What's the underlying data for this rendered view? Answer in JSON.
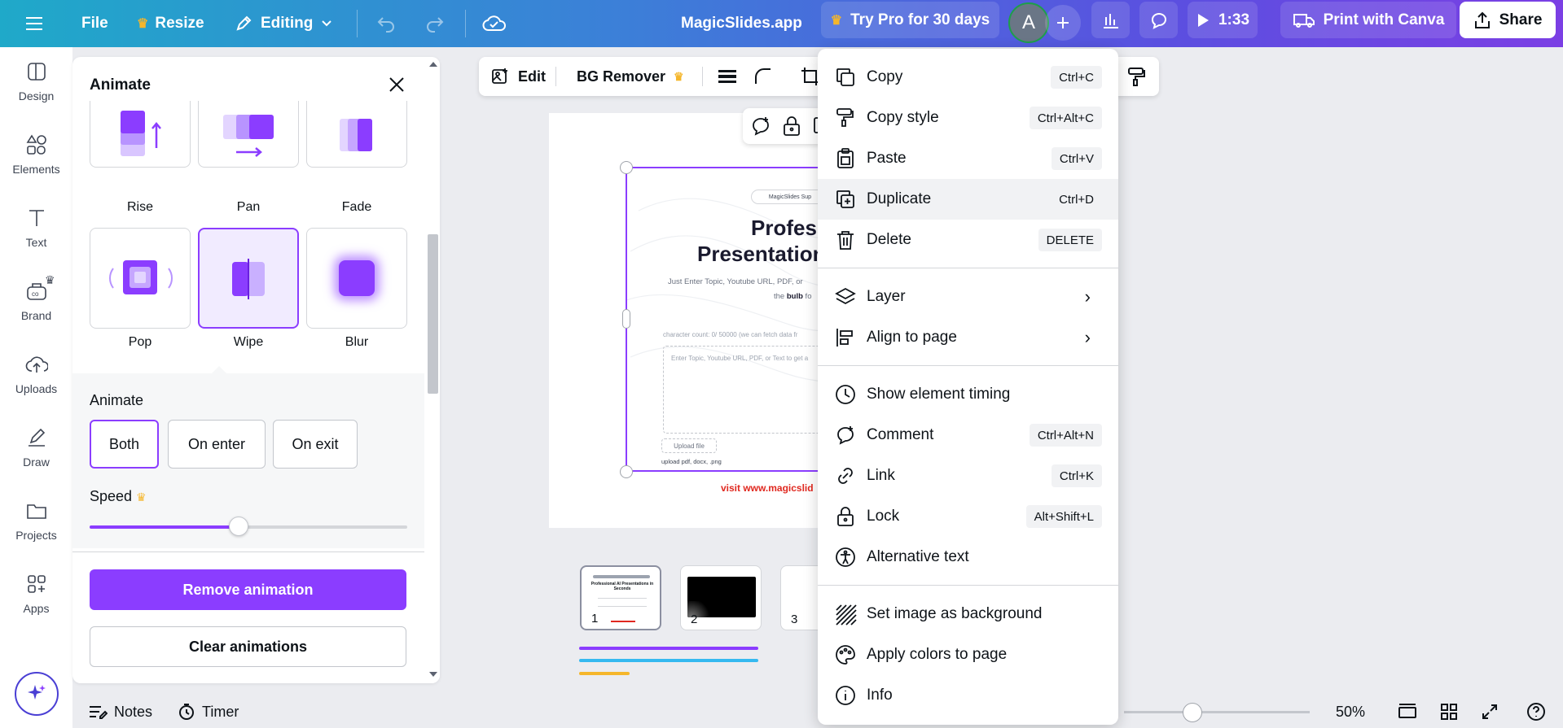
{
  "topbar": {
    "file": "File",
    "resize": "Resize",
    "editing": "Editing",
    "doc_title": "MagicSlides.app",
    "try_pro": "Try Pro for 30 days",
    "avatar_letter": "A",
    "play_time": "1:33",
    "print": "Print with Canva",
    "share": "Share"
  },
  "rail": [
    {
      "label": "Design",
      "icon": "design-icon"
    },
    {
      "label": "Elements",
      "icon": "elements-icon"
    },
    {
      "label": "Text",
      "icon": "text-icon"
    },
    {
      "label": "Brand",
      "icon": "brand-icon"
    },
    {
      "label": "Uploads",
      "icon": "uploads-icon"
    },
    {
      "label": "Draw",
      "icon": "draw-icon"
    },
    {
      "label": "Projects",
      "icon": "projects-icon"
    },
    {
      "label": "Apps",
      "icon": "apps-icon"
    }
  ],
  "panel": {
    "title": "Animate",
    "animations": [
      "Rise",
      "Pan",
      "Fade",
      "Pop",
      "Wipe",
      "Blur"
    ],
    "selected_animation": "Wipe",
    "animate_label": "Animate",
    "options": [
      "Both",
      "On enter",
      "On exit"
    ],
    "selected_option": "Both",
    "speed_label": "Speed",
    "speed_fraction": 0.47,
    "remove": "Remove animation",
    "clear": "Clear animations"
  },
  "edit_toolbar": {
    "edit": "Edit",
    "bg_remover": "BG Remover"
  },
  "slide": {
    "brand": "MagicSlides Sup",
    "heading_line1": "Profess",
    "heading_line2": "Presentation",
    "sub1": "Just Enter Topic, Youtube URL, PDF, or",
    "sub2_pre": "the ",
    "sub2_bold": "bulb",
    "sub2_post": " fo",
    "char_count": "character count: 0/ 50000 (we can fetch data fr",
    "input_placeholder": "Enter Topic, Youtube URL, PDF, or Text to get a",
    "upload": "Upload file",
    "upload_types": "upload pdf, docx, .png",
    "footer": "visit www.magicslid"
  },
  "thumbnails": [
    {
      "num": "1",
      "title": "Professional AI Presentations in Seconds"
    },
    {
      "num": "2"
    },
    {
      "num": "3"
    }
  ],
  "bottom": {
    "notes": "Notes",
    "timer": "Timer",
    "zoom": "50%"
  },
  "menu": [
    {
      "label": "Copy",
      "shortcut": "Ctrl+C",
      "icon": "copy-icon"
    },
    {
      "label": "Copy style",
      "shortcut": "Ctrl+Alt+C",
      "icon": "paint-roller-icon"
    },
    {
      "label": "Paste",
      "shortcut": "Ctrl+V",
      "icon": "clipboard-icon"
    },
    {
      "label": "Duplicate",
      "shortcut": "Ctrl+D",
      "icon": "duplicate-icon"
    },
    {
      "label": "Delete",
      "shortcut": "DELETE",
      "icon": "trash-icon"
    },
    {
      "label": "Layer",
      "icon": "layers-icon"
    },
    {
      "label": "Align to page",
      "icon": "align-icon"
    },
    {
      "label": "Show element timing",
      "icon": "clock-icon"
    },
    {
      "label": "Comment",
      "shortcut": "Ctrl+Alt+N",
      "icon": "comment-icon"
    },
    {
      "label": "Link",
      "shortcut": "Ctrl+K",
      "icon": "link-icon"
    },
    {
      "label": "Lock",
      "shortcut": "Alt+Shift+L",
      "icon": "lock-icon"
    },
    {
      "label": "Alternative text",
      "icon": "accessibility-icon"
    },
    {
      "label": "Set image as background",
      "icon": "hatch-icon"
    },
    {
      "label": "Apply colors to page",
      "icon": "palette-icon"
    },
    {
      "label": "Info",
      "icon": "info-icon"
    }
  ],
  "colors": {
    "accent": "#8b3dff",
    "topbar_start": "#1fa9c9",
    "topbar_end": "#7b3fe4",
    "crown": "#f5b62b",
    "footer_red": "#e0281f"
  }
}
